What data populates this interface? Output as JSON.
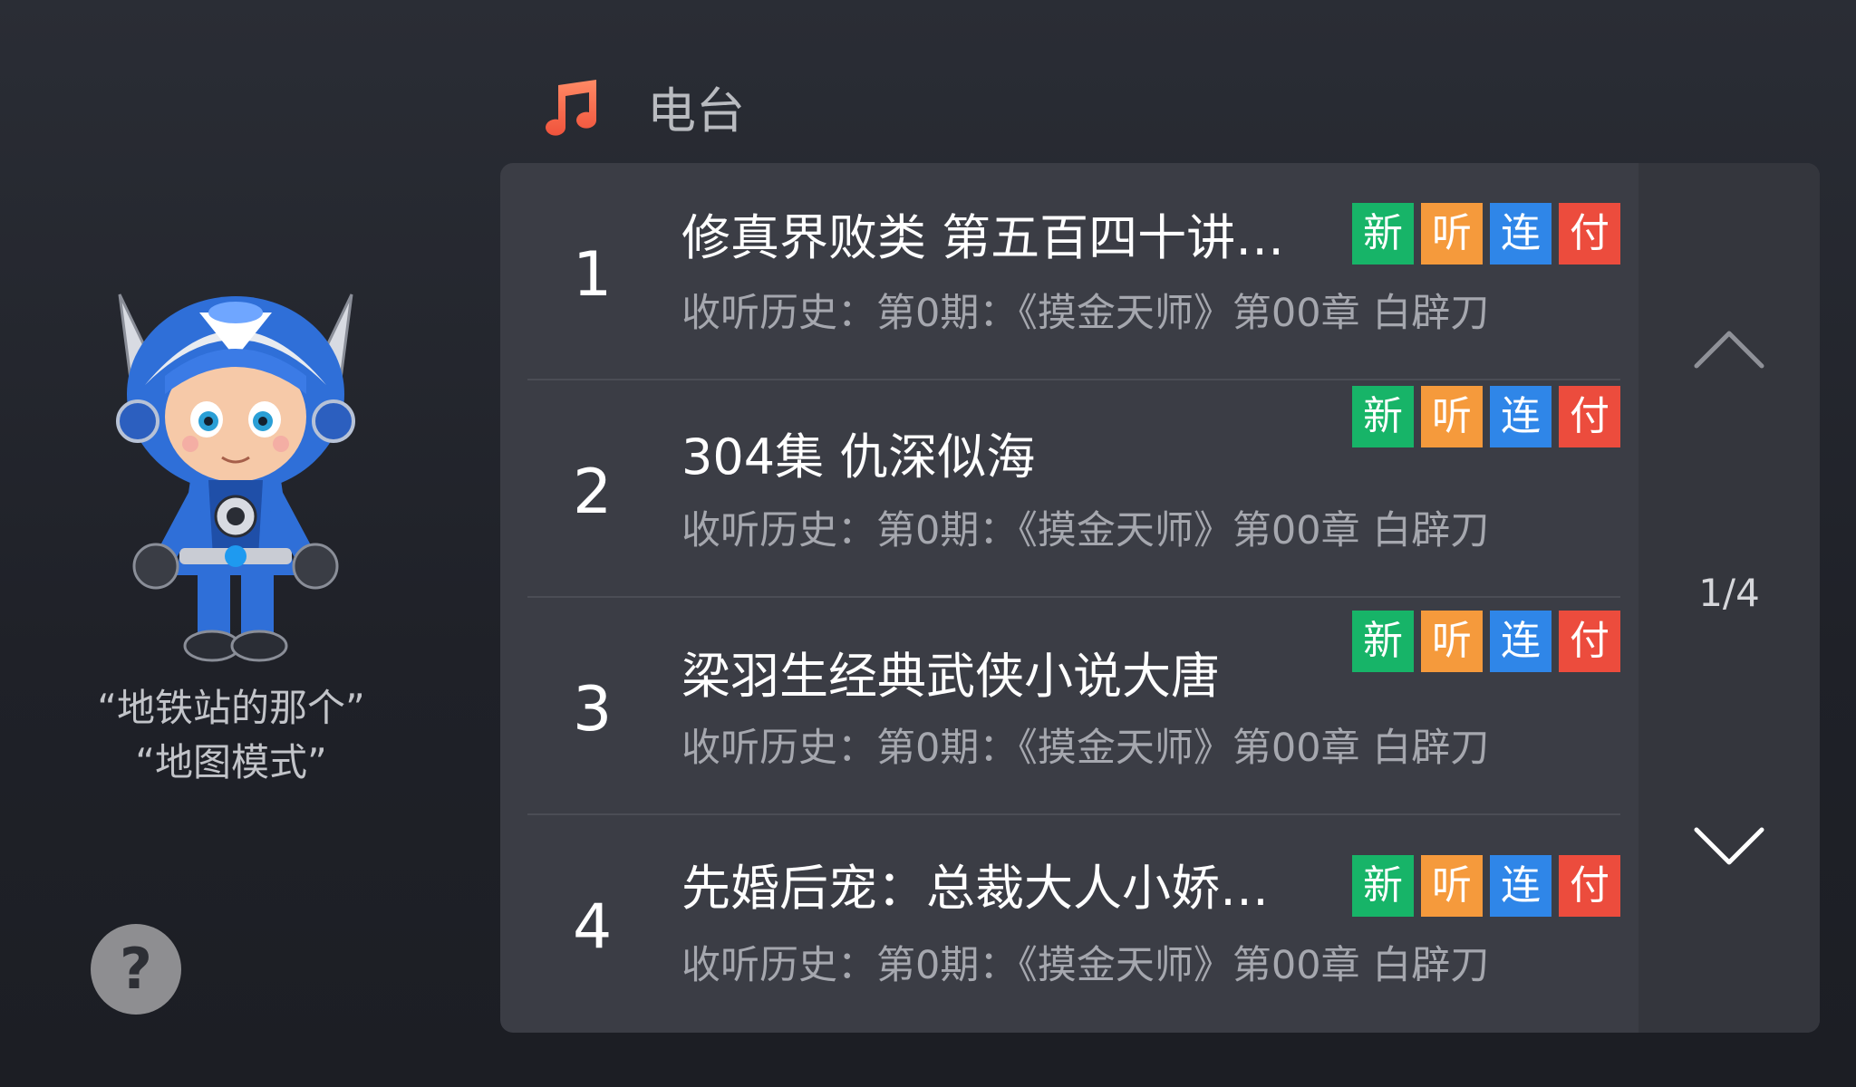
{
  "header": {
    "icon": "music-note-icon",
    "title": "电台"
  },
  "assistant": {
    "hint_lines": [
      "“地铁站的那个”",
      "“地图模式”"
    ],
    "help_label": "?"
  },
  "badges": [
    {
      "label": "新",
      "color": "#17b468"
    },
    {
      "label": "听",
      "color": "#f59a3c"
    },
    {
      "label": "连",
      "color": "#2f86e8"
    },
    {
      "label": "付",
      "color": "#ec4c3d"
    }
  ],
  "items": [
    {
      "index": "1",
      "title": "修真界败类 第五百四十讲…",
      "subtitle": "收听历史：第0期：《摸金天师》第00章 白辟刀"
    },
    {
      "index": "2",
      "title": "304集 仇深似海",
      "subtitle": "收听历史：第0期：《摸金天师》第00章 白辟刀"
    },
    {
      "index": "3",
      "title": "梁羽生经典武侠小说大唐",
      "subtitle": "收听历史：第0期：《摸金天师》第00章 白辟刀"
    },
    {
      "index": "4",
      "title": "先婚后宠：总裁大人小娇…",
      "subtitle": "收听历史：第0期：《摸金天师》第00章 白辟刀"
    }
  ],
  "pager": {
    "indicator": "1/4",
    "up_icon": "chevron-up-icon",
    "down_icon": "chevron-down-icon"
  }
}
